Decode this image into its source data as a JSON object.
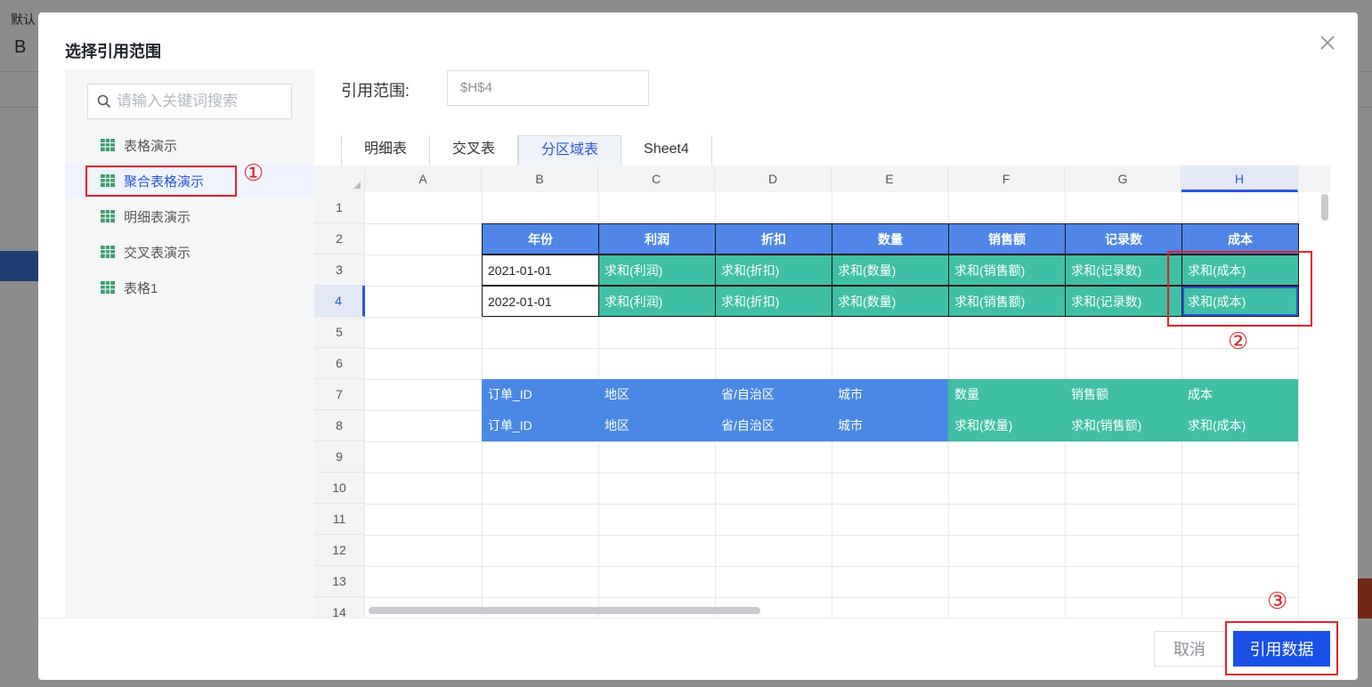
{
  "background": {
    "top_text": "默认",
    "top_letter": "B"
  },
  "dialog": {
    "title": "选择引用范围",
    "close_icon": "close-icon"
  },
  "left_panel": {
    "search_placeholder": "请输入关键词搜索",
    "items": [
      {
        "label": "表格演示",
        "active": false
      },
      {
        "label": "聚合表格演示",
        "active": true
      },
      {
        "label": "明细表演示",
        "active": false
      },
      {
        "label": "交叉表演示",
        "active": false
      },
      {
        "label": "表格1",
        "active": false
      }
    ]
  },
  "range": {
    "label": "引用范围:",
    "value": "$H$4"
  },
  "tabs": [
    {
      "label": "明细表",
      "active": false
    },
    {
      "label": "交叉表",
      "active": false
    },
    {
      "label": "分区域表",
      "active": true
    },
    {
      "label": "Sheet4",
      "active": false
    }
  ],
  "sheet": {
    "columns": [
      "A",
      "B",
      "C",
      "D",
      "E",
      "F",
      "G",
      "H"
    ],
    "selected_column": "H",
    "rows": [
      "1",
      "2",
      "3",
      "4",
      "5",
      "6",
      "7",
      "8",
      "9",
      "10",
      "11",
      "12",
      "13",
      "14"
    ],
    "selected_row": "4",
    "header_row": [
      "年份",
      "利润",
      "折扣",
      "数量",
      "销售额",
      "记录数",
      "成本"
    ],
    "row3": [
      "2021-01-01",
      "求和(利润)",
      "求和(折扣)",
      "求和(数量)",
      "求和(销售额)",
      "求和(记录数)",
      "求和(成本)"
    ],
    "row4": [
      "2022-01-01",
      "求和(利润)",
      "求和(折扣)",
      "求和(数量)",
      "求和(销售额)",
      "求和(记录数)",
      "求和(成本)"
    ],
    "row7": [
      "订单_ID",
      "地区",
      "省/自治区",
      "城市",
      "数量",
      "销售额",
      "成本"
    ],
    "row8": [
      "订单_ID",
      "地区",
      "省/自治区",
      "城市",
      "求和(数量)",
      "求和(销售额)",
      "求和(成本)"
    ]
  },
  "annotations": [
    "①",
    "②",
    "③"
  ],
  "buttons": {
    "cancel": "取消",
    "confirm": "引用数据"
  },
  "colors": {
    "primary": "#1a4fe8",
    "header_blue": "#4f86e8",
    "green": "#3fbfa5",
    "annotation_red": "#e0242a"
  }
}
